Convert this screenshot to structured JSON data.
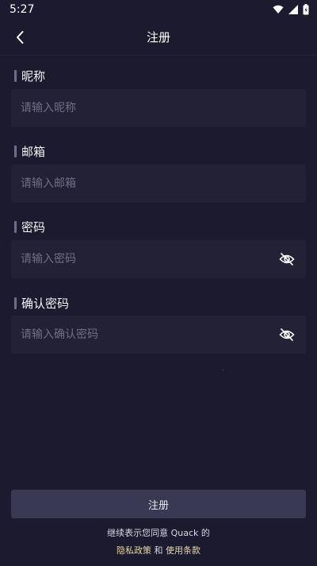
{
  "status_bar": {
    "time": "5:27"
  },
  "app_bar": {
    "title": "注册"
  },
  "fields": [
    {
      "label": "昵称",
      "placeholder": "请输入昵称"
    },
    {
      "label": "邮箱",
      "placeholder": "请输入邮箱"
    },
    {
      "label": "密码",
      "placeholder": "请输入密码"
    },
    {
      "label": "确认密码",
      "placeholder": "请输入确认密码"
    }
  ],
  "submit": {
    "label": "注册"
  },
  "terms": {
    "line1": "继续表示您同意 Quack 的",
    "privacy_link": "隐私政策",
    "and": "和",
    "terms_link": "使用条款"
  },
  "icons": {
    "back": "back-arrow-icon",
    "toggle_visibility": "eye-off-icon"
  },
  "colors": {
    "background": "#1b1a2e",
    "field_background": "#222136",
    "button_background": "#3a3954",
    "link": "#e6d7a8"
  }
}
